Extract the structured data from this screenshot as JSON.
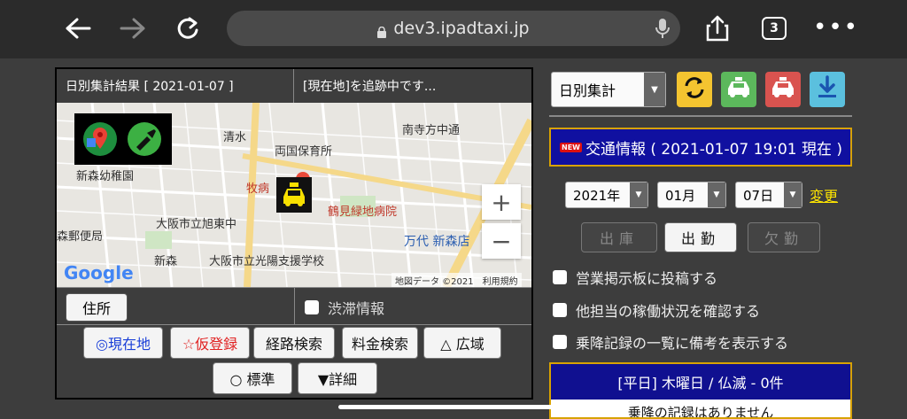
{
  "browser": {
    "url": "dev3.ipadtaxi.jp",
    "tab_count": "3"
  },
  "map_panel": {
    "header_left": "日別集計結果 [ 2021-01-07 ]",
    "header_right": "[現在地]を追跡中です...",
    "labels": {
      "minamiteranocho": "南寺方中通",
      "shimizu": "清水",
      "ryogoku_nursery": "両国保育所",
      "shinmori_kindergarten": "新森幼稚園",
      "makino": "牧病",
      "tsurumi_hospital": "鶴見緑地病院",
      "asahi_jhs": "大阪市立旭東中",
      "moriyubin": "森郵便局",
      "mandai": "万代 新森店",
      "shinmori": "新森",
      "komyo_school": "大阪市立光陽支援学校",
      "credit": "地図データ ©2021　利用規約",
      "google": "Google"
    },
    "address_button": "住所",
    "traffic_label": "渋滞情報",
    "actions": {
      "current_location": "◎現在地",
      "temp_register": "☆仮登録",
      "route_search": "経路検索",
      "fare_search": "料金検索",
      "wide_area": "△ 広域",
      "standard": "○ 標準",
      "detail": "▼詳細"
    }
  },
  "right_panel": {
    "mode_select": "日別集計",
    "news_badge": "NEW",
    "news_text": "交通情報 ( 2021-01-07 19:01 現在 )",
    "year": "2021年",
    "month": "01月",
    "day": "07日",
    "change_link": "変更",
    "btn_out": "出庫",
    "btn_work": "出勤",
    "btn_absent": "欠勤",
    "options": [
      "営業掲示板に投稿する",
      "他担当の稼働状況を確認する",
      "乗降記録の一覧に備考を表示する"
    ],
    "info_title": "[平日] 木曜日 / 仏滅 - 0件",
    "info_body": "乗降の記録はありません"
  },
  "colors": {
    "news_bg": "#1010a0",
    "accent_border": "#d8a200",
    "link": "#ffe600",
    "btn_refresh": "#f4c430",
    "btn_taxi_green": "#5cb85c",
    "btn_taxi_red": "#d9534f",
    "btn_download": "#5bc0de"
  }
}
